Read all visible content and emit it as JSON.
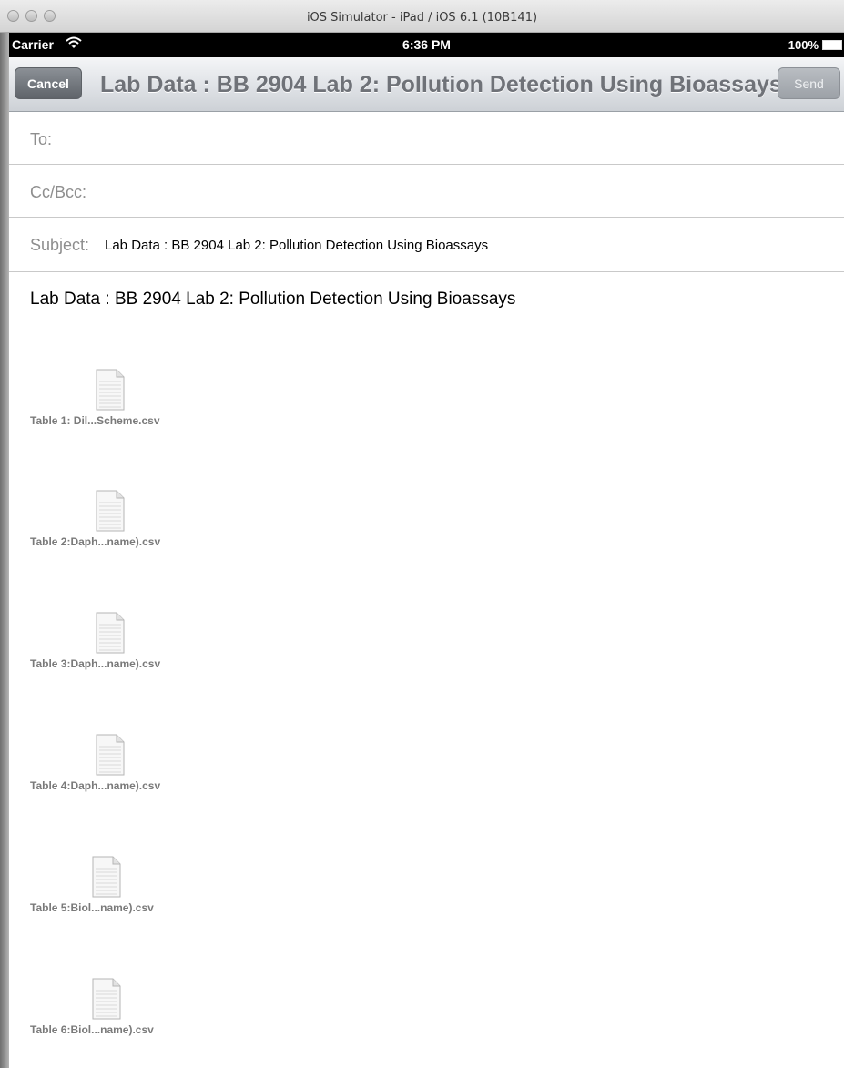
{
  "window": {
    "title": "iOS Simulator - iPad / iOS 6.1 (10B141)"
  },
  "status_bar": {
    "carrier": "Carrier",
    "time": "6:36 PM",
    "battery": "100%"
  },
  "nav_bar": {
    "cancel_label": "Cancel",
    "title": "Lab Data : BB 2904 Lab 2: Pollution Detection Using Bioassays",
    "send_label": "Send"
  },
  "fields": {
    "to_label": "To:",
    "cc_bcc_label": "Cc/Bcc:",
    "subject_label": "Subject:",
    "subject_value": "Lab Data : BB 2904 Lab 2: Pollution Detection Using Bioassays"
  },
  "body": {
    "text": "Lab Data : BB 2904 Lab 2: Pollution Detection Using Bioassays"
  },
  "attachments": [
    {
      "name": "Table 1: Dil...Scheme.csv",
      "icon": "document-icon"
    },
    {
      "name": "Table 2:Daph...name).csv",
      "icon": "document-icon"
    },
    {
      "name": "Table 3:Daph...name).csv",
      "icon": "document-icon"
    },
    {
      "name": "Table 4:Daph...name).csv",
      "icon": "document-icon"
    },
    {
      "name": "Table 5:Biol...name).csv",
      "icon": "document-icon"
    },
    {
      "name": "Table 6:Biol...name).csv",
      "icon": "document-icon"
    }
  ]
}
